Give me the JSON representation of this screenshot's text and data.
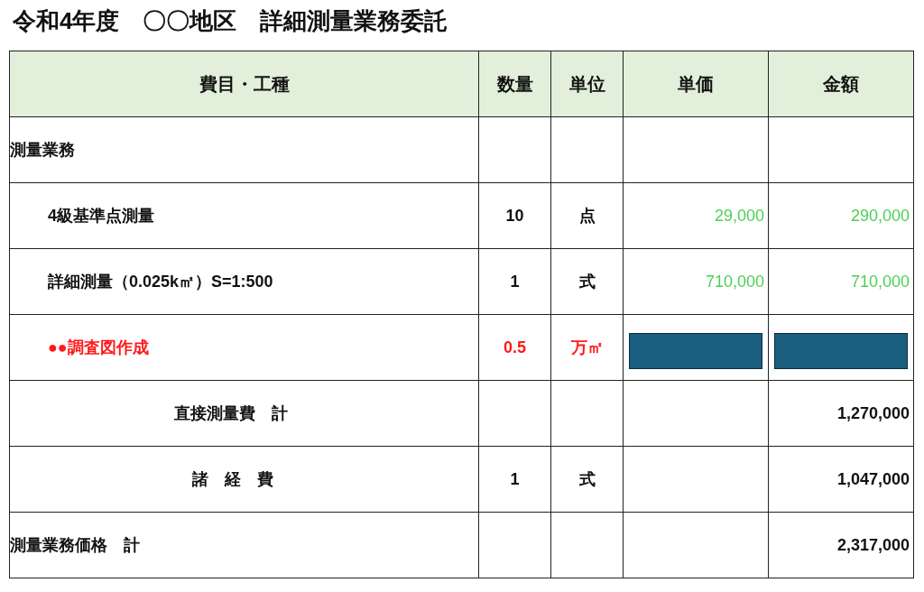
{
  "title": "令和4年度　〇〇地区　詳細測量業務委託",
  "table": {
    "columns": [
      "費目・工種",
      "数量",
      "単位",
      "単価",
      "金額"
    ],
    "rows": [
      {
        "kind": "section",
        "item": "測量業務"
      },
      {
        "kind": "item",
        "item": "4級基準点測量",
        "quantity": "10",
        "unit": "点",
        "unit_price": "29,000",
        "amount": "290,000"
      },
      {
        "kind": "item",
        "item": "詳細測量（0.025k㎡）S=1:500",
        "quantity": "1",
        "unit": "式",
        "unit_price": "710,000",
        "amount": "710,000"
      },
      {
        "kind": "flagged",
        "item": "●●調査図作成",
        "quantity": "0.5",
        "unit": "万㎡"
      },
      {
        "kind": "subtotal",
        "item": "直接測量費　計",
        "amount": "1,270,000"
      },
      {
        "kind": "expense",
        "item": "諸　経　費",
        "quantity": "1",
        "unit": "式",
        "amount": "1,047,000"
      },
      {
        "kind": "total",
        "item": "測量業務価格　計",
        "amount": "2,317,000"
      }
    ]
  }
}
